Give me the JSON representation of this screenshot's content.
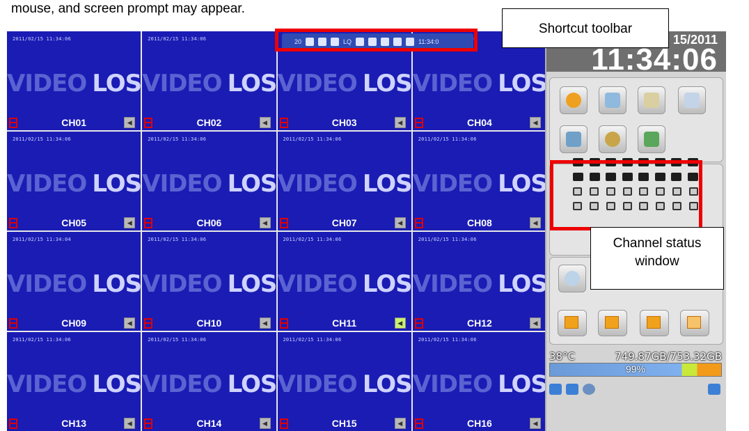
{
  "caption": "mouse, and screen prompt may appear.",
  "channels": [
    {
      "ts": "2011/02/15 11:34:06",
      "label": "CH01",
      "audio_active": false
    },
    {
      "ts": "2011/02/15 11:34:06",
      "label": "CH02",
      "audio_active": false
    },
    {
      "ts": "2011/02/15 11:34:06",
      "label": "CH03",
      "audio_active": false
    },
    {
      "ts": "2011/02/15 11:34:06",
      "label": "CH04",
      "audio_active": false
    },
    {
      "ts": "2011/02/15 11:34:06",
      "label": "CH05",
      "audio_active": false
    },
    {
      "ts": "2011/02/15 11:34:06",
      "label": "CH06",
      "audio_active": false
    },
    {
      "ts": "2011/02/15 11:34:06",
      "label": "CH07",
      "audio_active": false
    },
    {
      "ts": "2011/02/15 11:34:06",
      "label": "CH08",
      "audio_active": false
    },
    {
      "ts": "2011/02/15 11:34:04",
      "label": "CH09",
      "audio_active": false
    },
    {
      "ts": "2011/02/15 11:34:06",
      "label": "CH10",
      "audio_active": false
    },
    {
      "ts": "2011/02/15 11:34:06",
      "label": "CH11",
      "audio_active": true
    },
    {
      "ts": "2011/02/15 11:34:06",
      "label": "CH12",
      "audio_active": false
    },
    {
      "ts": "2011/02/15 11:34:06",
      "label": "CH13",
      "audio_active": false
    },
    {
      "ts": "2011/02/15 11:34:06",
      "label": "CH14",
      "audio_active": false
    },
    {
      "ts": "2011/02/15 11:34:06",
      "label": "CH15",
      "audio_active": false
    },
    {
      "ts": "2011/02/15 11:34:06",
      "label": "CH16",
      "audio_active": false
    }
  ],
  "video_loss": {
    "word1": "VIDEO",
    "word2": "LOSS"
  },
  "toolbar": {
    "prefix": "20",
    "time": "11:34:0",
    "icons": [
      "lock-icon",
      "info-icon",
      "chat-icon",
      "lq-icon",
      "camera-icon",
      "record-icon",
      "snapshot-icon",
      "chart-icon",
      "settings-icon"
    ],
    "lq_label": "LQ"
  },
  "clock": {
    "date": "15/2011",
    "time": "11:34:06"
  },
  "status": {
    "temperature": "38°C",
    "disk": "749.87GB/753.32GB",
    "usage_label": "99%",
    "usage_fraction": 0.99
  },
  "callouts": {
    "toolbar": "Shortcut toolbar",
    "status_line1": "Channel status",
    "status_line2": "window"
  },
  "colors": {
    "video_bg": "#1a1cb4",
    "highlight": "#ee0000",
    "audio_active": "#c8f070"
  }
}
